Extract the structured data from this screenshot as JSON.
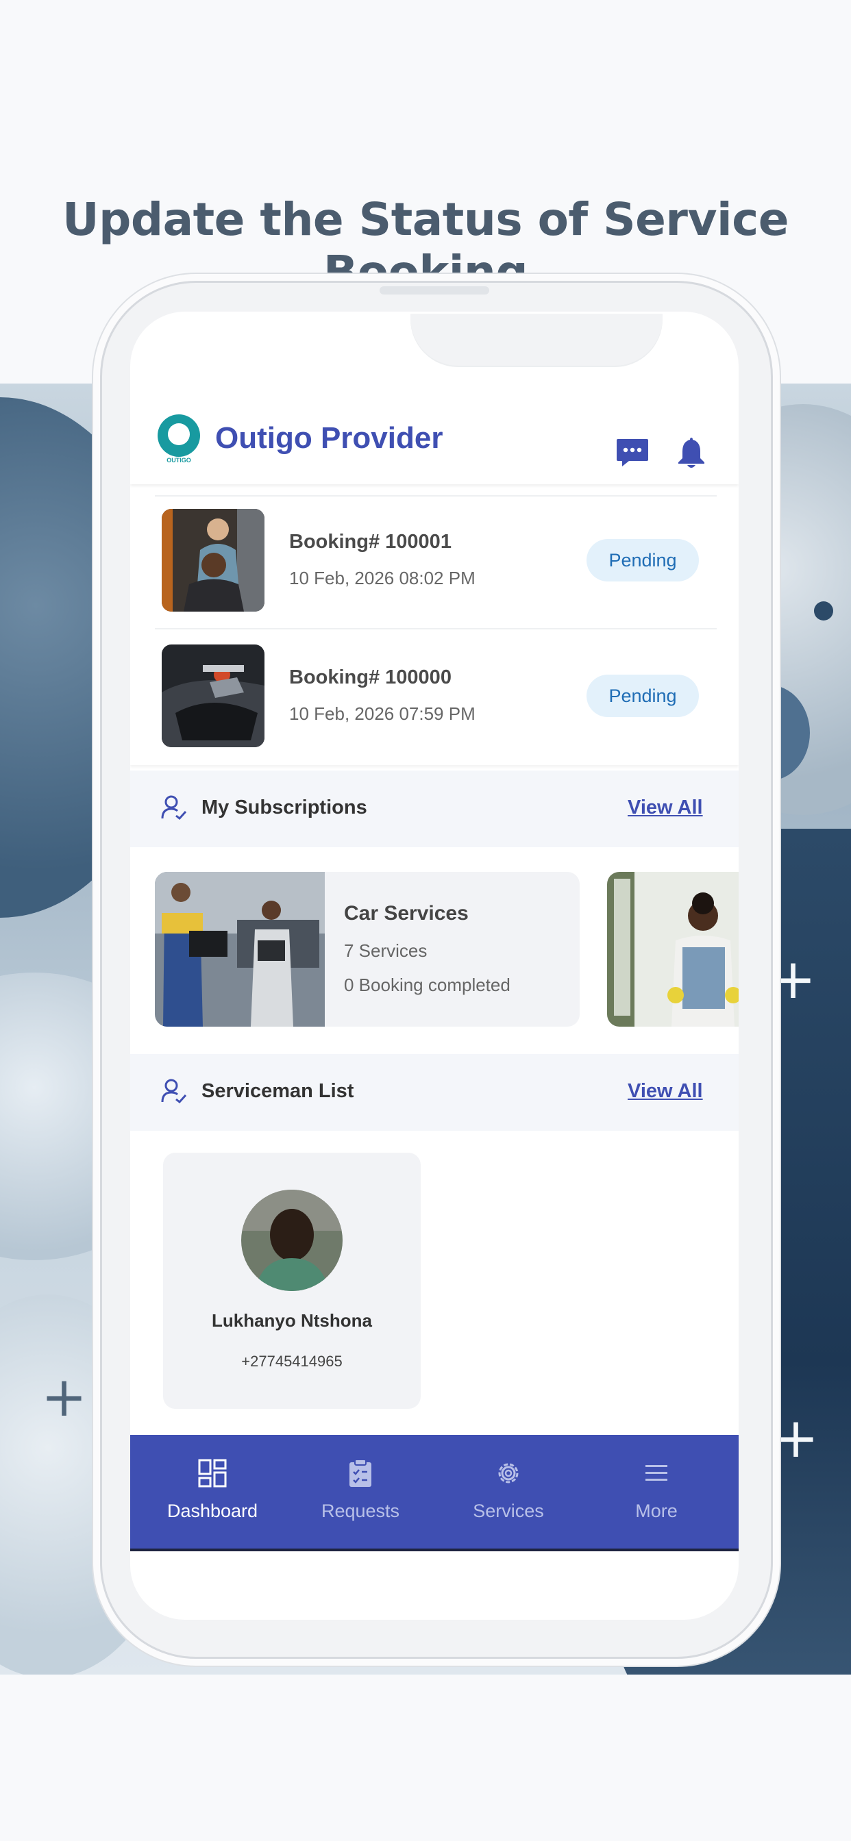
{
  "headline": "Update the Status of Service Booking",
  "app": {
    "logo_text": "OUTIGO",
    "title": "Outigo Provider",
    "accent_color": "#3f4fb2",
    "logo_color": "#189aa0"
  },
  "bookings": [
    {
      "title": "Booking#  100001",
      "date": "10 Feb, 2026 08:02 PM",
      "status": "Pending"
    },
    {
      "title": "Booking#  100000",
      "date": "10 Feb, 2026 07:59 PM",
      "status": "Pending"
    }
  ],
  "subscriptions": {
    "header": "My Subscriptions",
    "view_all": "View All",
    "cards": [
      {
        "title": "Car Services",
        "services": "7 Services",
        "bookings": "0 Booking completed"
      }
    ]
  },
  "servicemen": {
    "header": "Serviceman List",
    "view_all": "View All",
    "items": [
      {
        "name": "Lukhanyo Ntshona",
        "phone": "+27745414965"
      }
    ]
  },
  "bottom_nav": {
    "items": [
      {
        "label": "Dashboard",
        "icon": "dashboard-icon",
        "active": true
      },
      {
        "label": "Requests",
        "icon": "clipboard-icon",
        "active": false
      },
      {
        "label": "Services",
        "icon": "gear-icon",
        "active": false
      },
      {
        "label": "More",
        "icon": "menu-icon",
        "active": false
      }
    ]
  }
}
